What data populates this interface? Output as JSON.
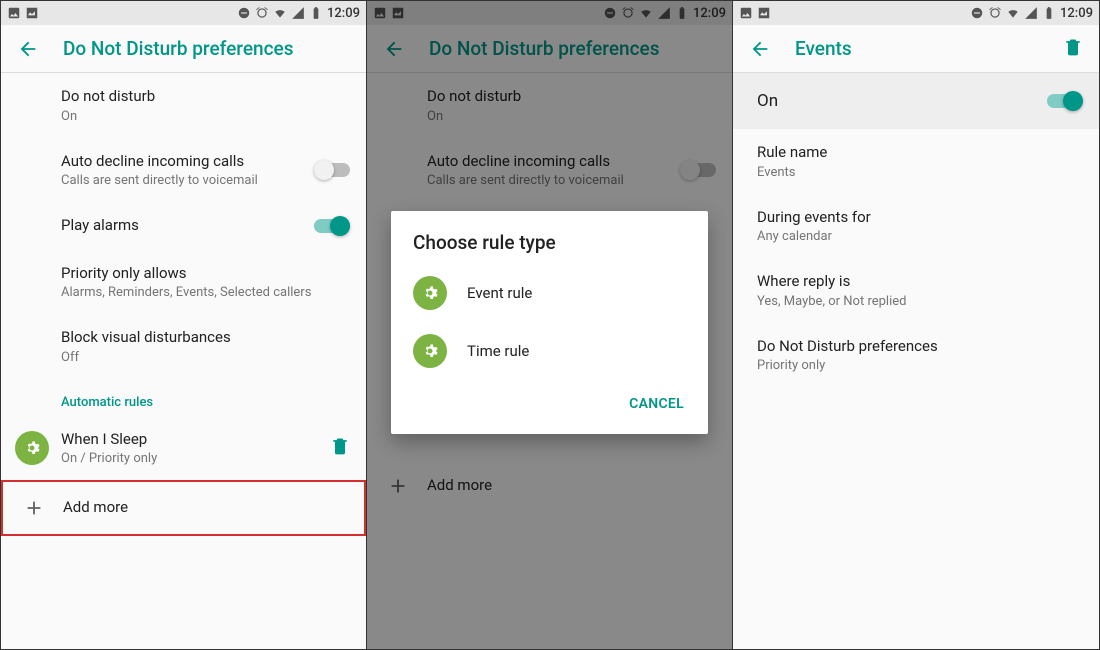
{
  "status": {
    "time": "12:09"
  },
  "panel1": {
    "title": "Do Not Disturb preferences",
    "rows": {
      "dnd": {
        "title": "Do not disturb",
        "sub": "On"
      },
      "auto_decline": {
        "title": "Auto decline incoming calls",
        "sub": "Calls are sent directly to voicemail"
      },
      "play_alarms": {
        "title": "Play alarms"
      },
      "priority": {
        "title": "Priority only allows",
        "sub": "Alarms, Reminders, Events, Selected callers"
      },
      "block_visual": {
        "title": "Block visual disturbances",
        "sub": "Off"
      }
    },
    "automatic_rules_header": "Automatic rules",
    "rule1": {
      "title": "When I Sleep",
      "sub": "On / Priority only"
    },
    "add_more": "Add more"
  },
  "panel2": {
    "title": "Do Not Disturb preferences",
    "rows": {
      "dnd": {
        "title": "Do not disturb",
        "sub": "On"
      },
      "auto_decline": {
        "title": "Auto decline incoming calls",
        "sub": "Calls are sent directly to voicemail"
      }
    },
    "add_more": "Add more",
    "dialog": {
      "title": "Choose rule type",
      "event_rule": "Event rule",
      "time_rule": "Time rule",
      "cancel": "CANCEL"
    }
  },
  "panel3": {
    "title": "Events",
    "toggle_label": "On",
    "rows": {
      "rule_name": {
        "title": "Rule name",
        "sub": "Events"
      },
      "during": {
        "title": "During events for",
        "sub": "Any calendar"
      },
      "where": {
        "title": "Where reply is",
        "sub": "Yes, Maybe, or Not replied"
      },
      "dnd_pref": {
        "title": "Do Not Disturb preferences",
        "sub": "Priority only"
      }
    }
  }
}
